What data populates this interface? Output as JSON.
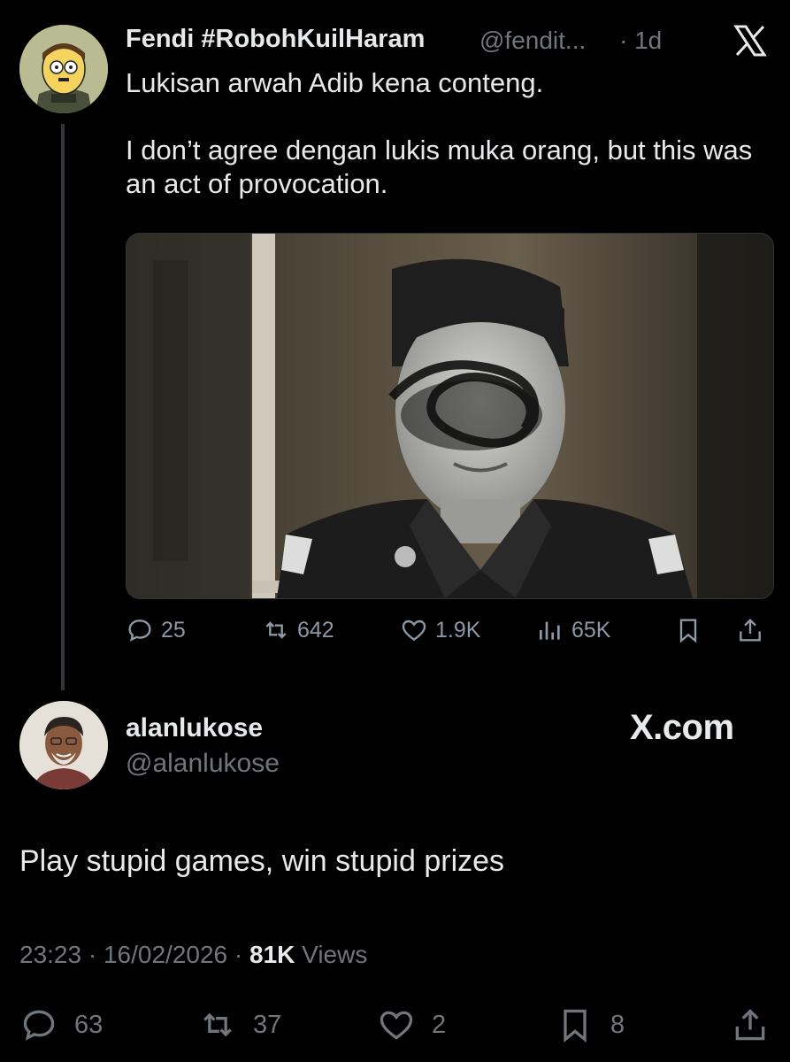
{
  "quoted_tweet": {
    "display_name": "Fendi #RobohKuilHaram",
    "handle": "@fendit...",
    "time": "· 1d",
    "text": "Lukisan arwah Adib kena conteng.\n\nI don’t agree dengan lukis muka orang, but this was an act of provocation.",
    "stats": {
      "replies": "25",
      "reposts": "642",
      "likes": "1.9K",
      "views": "65K"
    }
  },
  "reply_tweet": {
    "display_name": "alanlukose",
    "handle": "@alanlukose",
    "brand": "X.com",
    "text": "Play stupid games, win stupid prizes",
    "time": "23:23",
    "date": "16/02/2026",
    "views_count": "81K",
    "views_label": "Views",
    "stats": {
      "replies": "63",
      "reposts": "37",
      "likes": "2",
      "bookmarks": "8"
    }
  },
  "icons": [
    "x-logo-icon",
    "reply-icon",
    "repost-icon",
    "like-icon",
    "views-icon",
    "bookmark-icon",
    "share-icon"
  ],
  "colors": {
    "background": "#000000",
    "text": "#e7e9ea",
    "secondary": "#71767b"
  }
}
